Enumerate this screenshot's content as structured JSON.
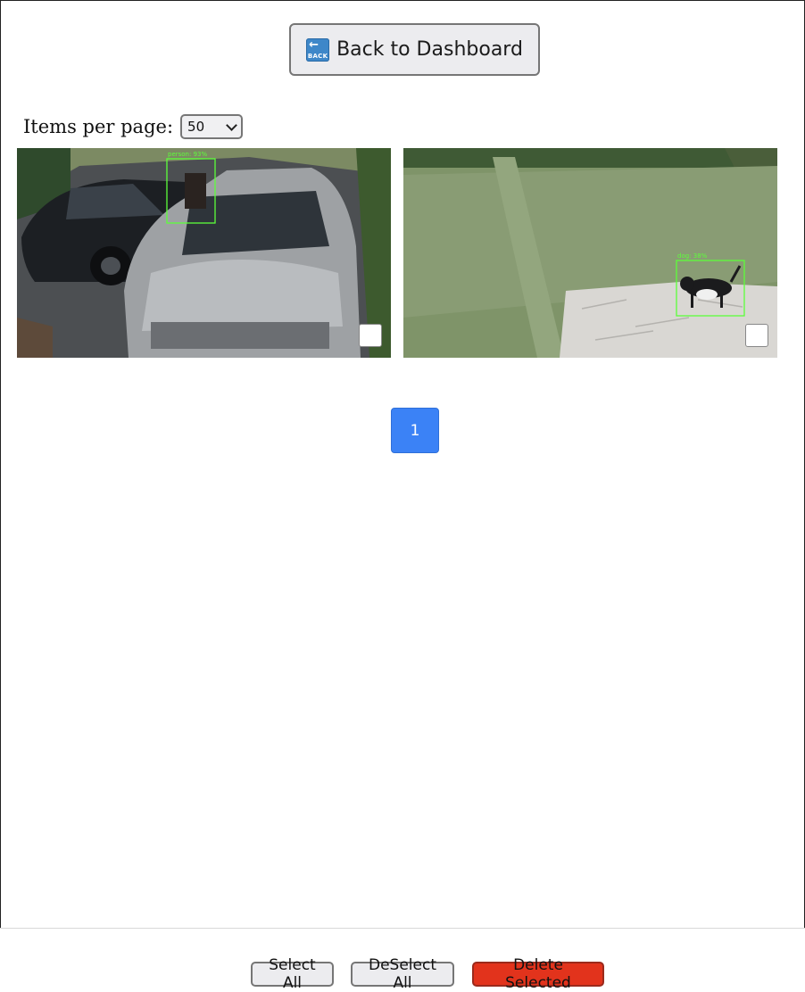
{
  "header": {
    "back_label": "Back to Dashboard",
    "back_icon": "back-arrow-icon",
    "back_icon_text": "BACK"
  },
  "pagination_settings": {
    "label": "Items per page:",
    "selected": "50"
  },
  "gallery": {
    "items": [
      {
        "detection": "person: 93%"
      },
      {
        "detection": "dog: 38%"
      }
    ]
  },
  "pagination": {
    "pages": [
      "1"
    ],
    "current": "1",
    "color": "#3b82f6"
  },
  "footer": {
    "select_all": "Select All",
    "deselect_all": "DeSelect All",
    "delete_selected": "Delete Selected",
    "delete_color": "#e2331c"
  }
}
